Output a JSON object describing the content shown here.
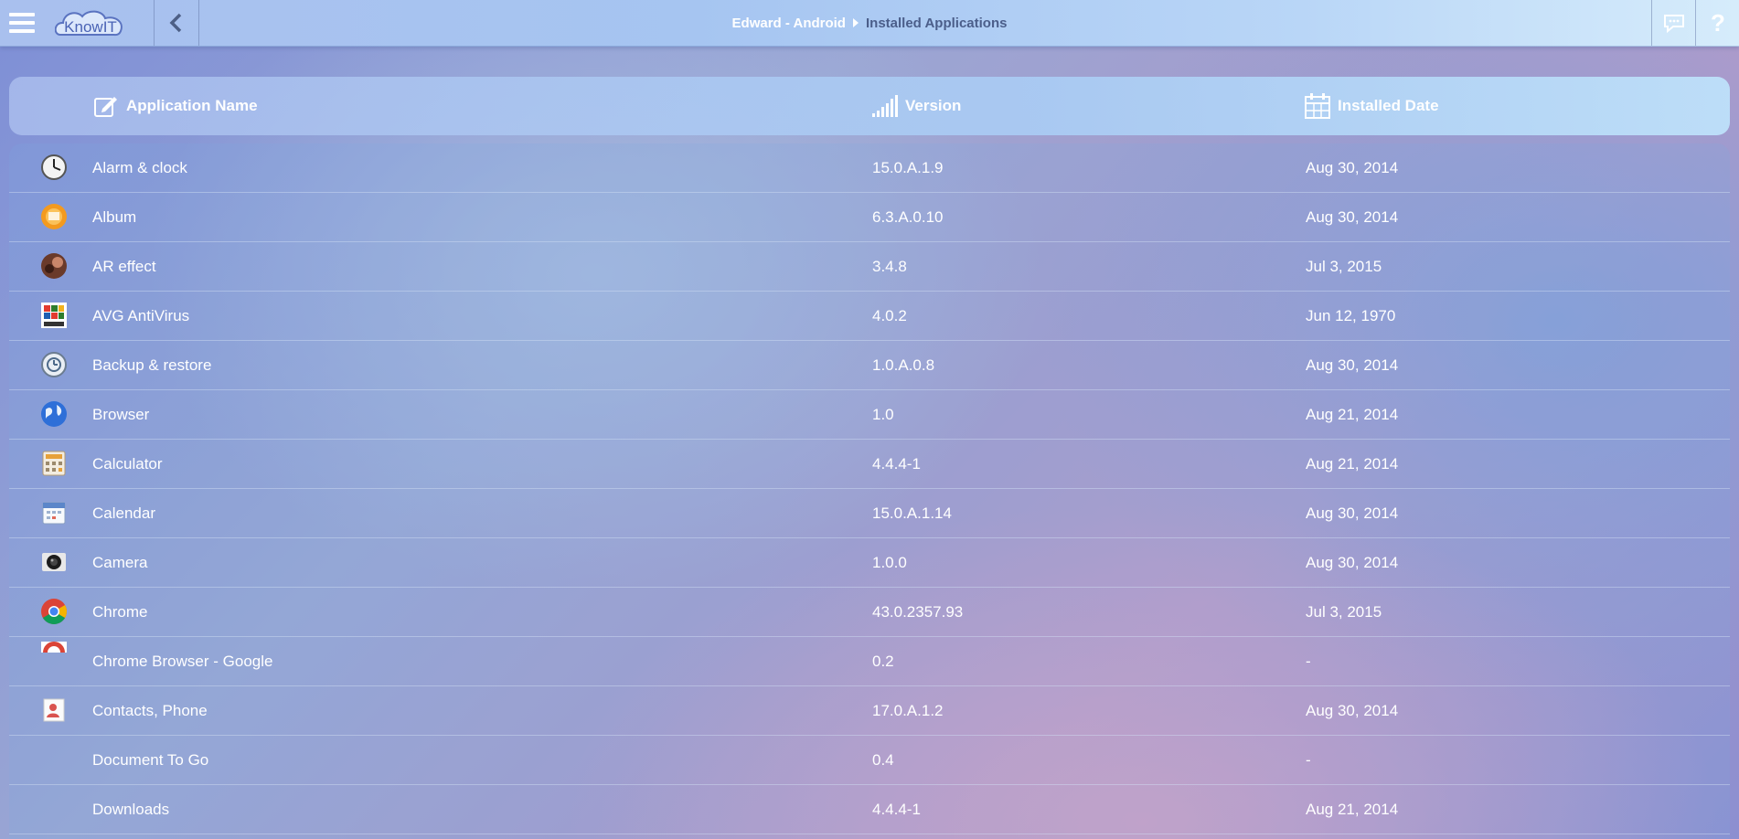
{
  "header": {
    "logo_text": "KnowIT",
    "breadcrumb": {
      "device": "Edward - Android",
      "page": "Installed Applications"
    },
    "help_label": "?"
  },
  "table": {
    "columns": {
      "name": "Application Name",
      "version": "Version",
      "date": "Installed Date"
    },
    "rows": [
      {
        "name": "Alarm & clock",
        "version": "15.0.A.1.9",
        "date": "Aug 30, 2014",
        "icon": "clock-icon"
      },
      {
        "name": "Album",
        "version": "6.3.A.0.10",
        "date": "Aug 30, 2014",
        "icon": "album-icon"
      },
      {
        "name": "AR effect",
        "version": "3.4.8",
        "date": "Jul 3, 2015",
        "icon": "ar-effect-icon"
      },
      {
        "name": "AVG AntiVirus",
        "version": "4.0.2",
        "date": "Jun 12, 1970",
        "icon": "avg-antivirus-icon"
      },
      {
        "name": "Backup & restore",
        "version": "1.0.A.0.8",
        "date": "Aug 30, 2014",
        "icon": "backup-restore-icon"
      },
      {
        "name": "Browser",
        "version": "1.0",
        "date": "Aug 21, 2014",
        "icon": "browser-globe-icon"
      },
      {
        "name": "Calculator",
        "version": "4.4.4-1",
        "date": "Aug 21, 2014",
        "icon": "calculator-icon"
      },
      {
        "name": "Calendar",
        "version": "15.0.A.1.14",
        "date": "Aug 30, 2014",
        "icon": "calendar-icon"
      },
      {
        "name": "Camera",
        "version": "1.0.0",
        "date": "Aug 30, 2014",
        "icon": "camera-icon"
      },
      {
        "name": "Chrome",
        "version": "43.0.2357.93",
        "date": "Jul 3, 2015",
        "icon": "chrome-icon"
      },
      {
        "name": "Chrome Browser - Google",
        "version": "0.2",
        "date": "-",
        "icon": "chrome-partial-icon"
      },
      {
        "name": "Contacts, Phone",
        "version": "17.0.A.1.2",
        "date": "Aug 30, 2014",
        "icon": "contacts-icon"
      },
      {
        "name": "Document To Go",
        "version": "0.4",
        "date": "-",
        "icon": ""
      },
      {
        "name": "Downloads",
        "version": "4.4.4-1",
        "date": "Aug 21, 2014",
        "icon": ""
      }
    ]
  }
}
